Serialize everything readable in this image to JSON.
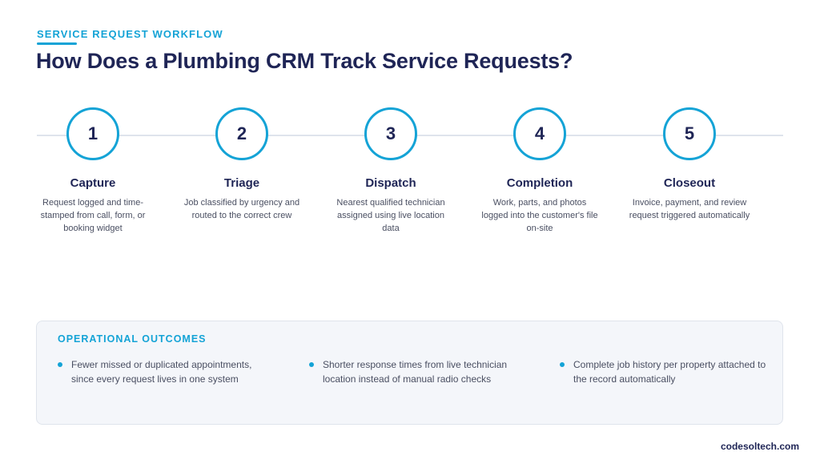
{
  "header": {
    "eyebrow": "SERVICE REQUEST WORKFLOW",
    "title": "How Does a Plumbing CRM Track Service Requests?"
  },
  "steps": [
    {
      "number": "1",
      "title": "Capture",
      "description": "Request logged and time-stamped from call, form, or booking widget"
    },
    {
      "number": "2",
      "title": "Triage",
      "description": "Job classified by urgency and routed to the correct crew"
    },
    {
      "number": "3",
      "title": "Dispatch",
      "description": "Nearest qualified technician assigned using live location data"
    },
    {
      "number": "4",
      "title": "Completion",
      "description": "Work, parts, and photos logged into the customer's file on-site"
    },
    {
      "number": "5",
      "title": "Closeout",
      "description": "Invoice, payment, and review request triggered automatically"
    }
  ],
  "outcomes": {
    "heading": "OPERATIONAL OUTCOMES",
    "items": [
      "Fewer missed or duplicated appointments, since every request lives in one system",
      "Shorter response times from live technician location instead of manual radio checks",
      "Complete job history per property attached to the record automatically"
    ]
  },
  "footer": {
    "brand": "codesoltech.com"
  },
  "colors": {
    "accent": "#14a3d6",
    "navy": "#1f2556",
    "body_text": "#4a4f62",
    "panel_bg": "#f4f6fa"
  }
}
